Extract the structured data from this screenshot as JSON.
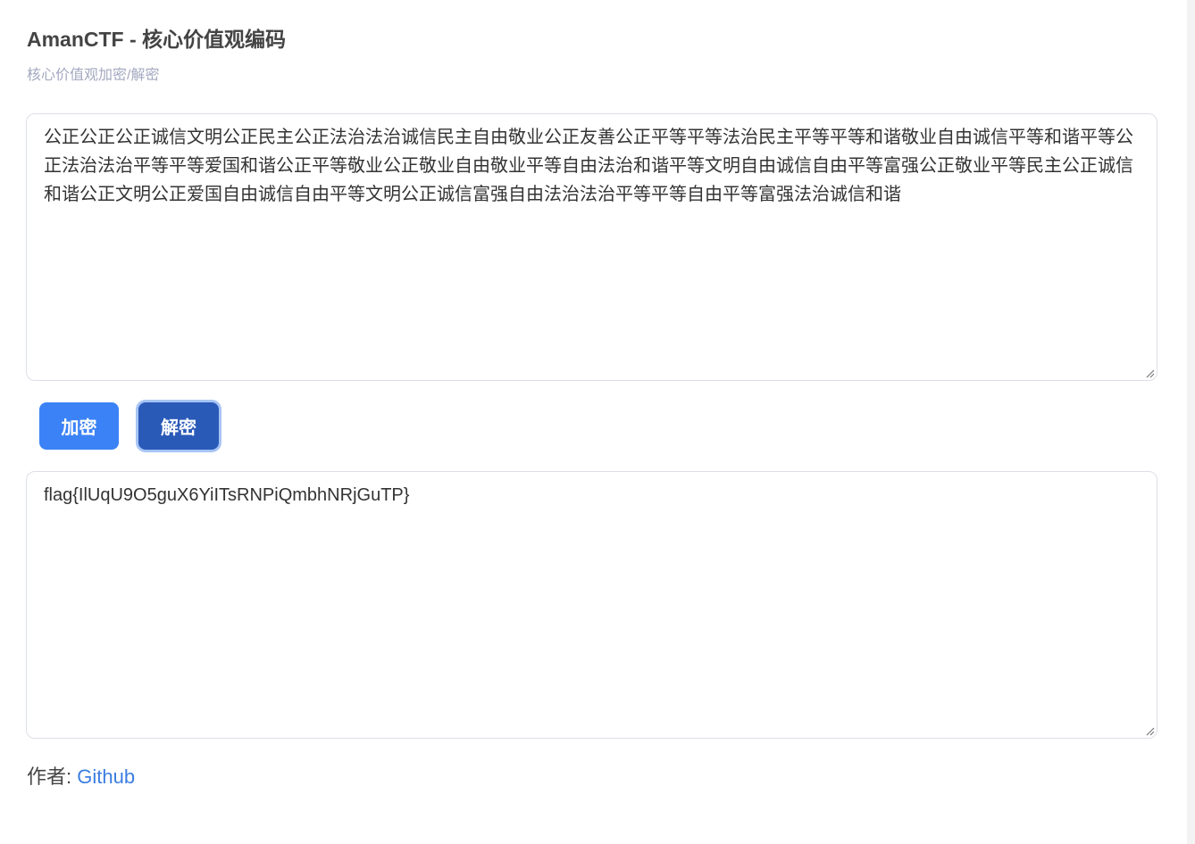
{
  "header": {
    "title": "AmanCTF - 核心价值观编码",
    "subtitle": "核心价值观加密/解密"
  },
  "input": {
    "value": "公正公正公正诚信文明公正民主公正法治法治诚信民主自由敬业公正友善公正平等平等法治民主平等平等和谐敬业自由诚信平等和谐平等公正法治法治平等平等爱国和谐公正平等敬业公正敬业自由敬业平等自由法治和谐平等文明自由诚信自由平等富强公正敬业平等民主公正诚信和谐公正文明公正爱国自由诚信自由平等文明公正诚信富强自由法治法治平等平等自由平等富强法治诚信和谐"
  },
  "buttons": {
    "encrypt_label": "加密",
    "decrypt_label": "解密"
  },
  "output": {
    "value": "flag{IlUqU9O5guX6YiITsRNPiQmbhNRjGuTP}"
  },
  "footer": {
    "author_label": "作者: ",
    "link_label": "Github"
  },
  "colors": {
    "encrypt_button": "#3b82f6",
    "decrypt_button_active": "#2a5ab8",
    "link": "#3b7de0"
  }
}
